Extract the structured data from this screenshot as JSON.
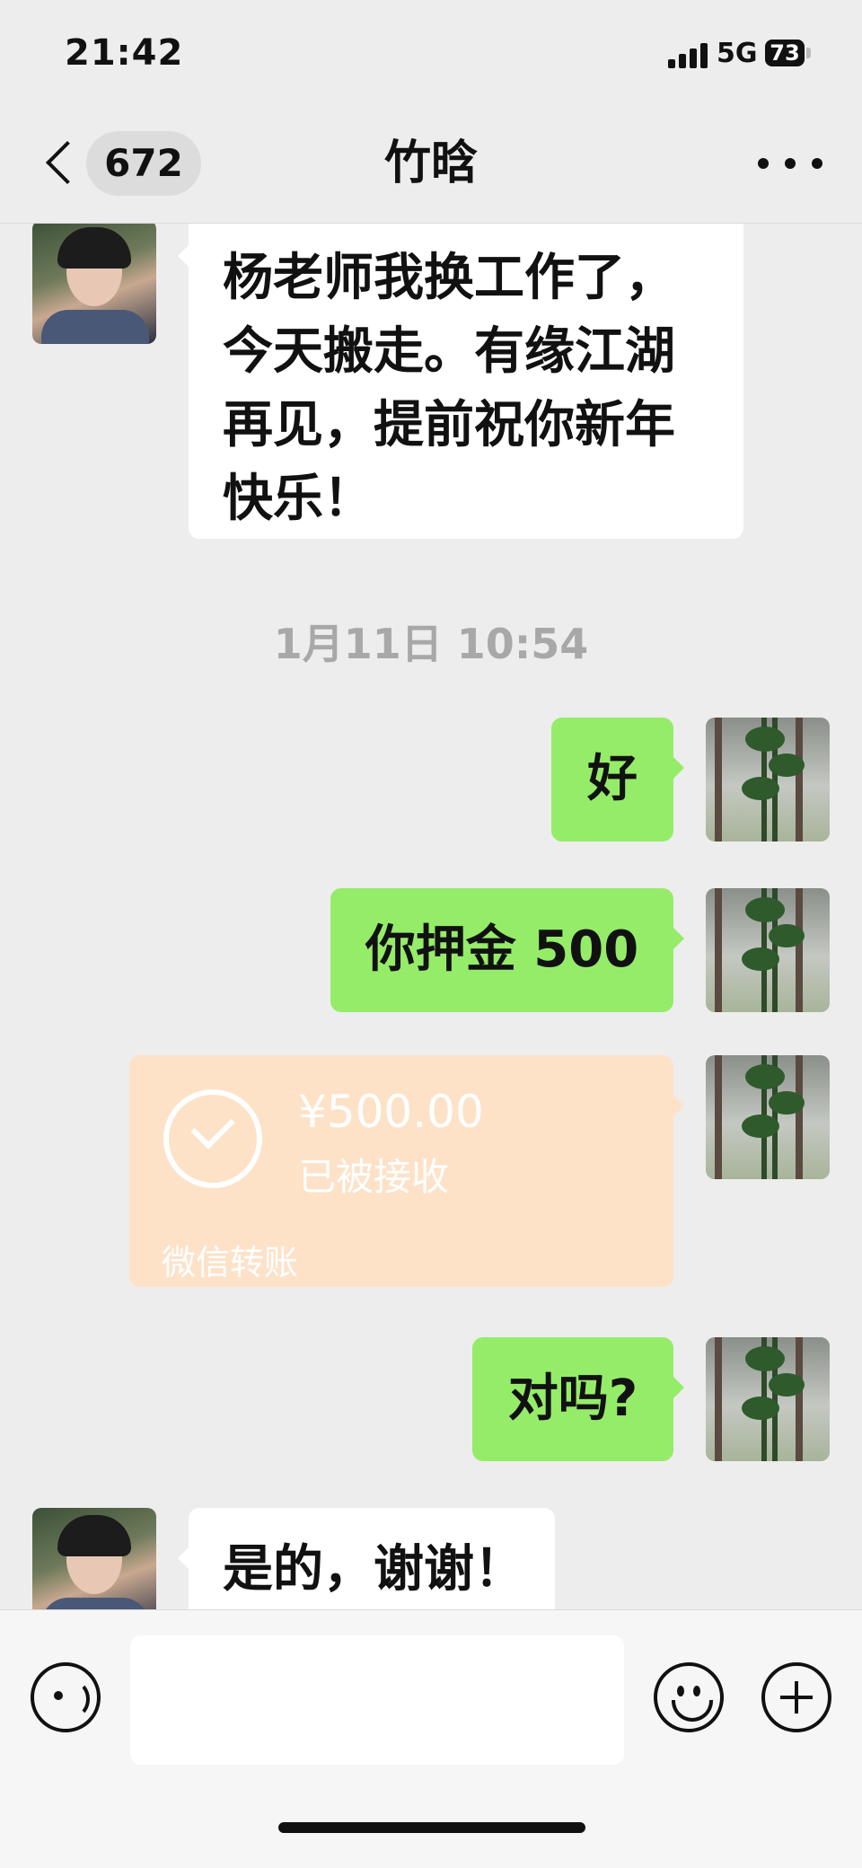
{
  "status_bar": {
    "time": "21:42",
    "network": "5G",
    "battery": "73"
  },
  "nav": {
    "unread_count": "672",
    "title": "竹晗"
  },
  "messages": [
    {
      "sender": "contact",
      "text": "杨老师我换工作了，今天搬走。有缘江湖再见，提前祝你新年快乐！"
    },
    {
      "timestamp": "1月11日 10:54"
    },
    {
      "sender": "me",
      "text": "好"
    },
    {
      "sender": "me",
      "text": "你押金 500"
    },
    {
      "sender": "me",
      "type": "transfer",
      "amount": "¥500.00",
      "status": "已被接收",
      "label": "微信转账"
    },
    {
      "sender": "me",
      "text": "对吗?"
    },
    {
      "sender": "contact",
      "text": "是的，谢谢！"
    }
  ],
  "input_bar": {
    "placeholder": ""
  },
  "colors": {
    "outgoing_bubble": "#95ec69",
    "incoming_bubble": "#ffffff",
    "transfer_card": "#fde2c8",
    "background": "#ededed"
  },
  "icons": [
    "back-chevron-icon",
    "more-icon",
    "voice-icon",
    "emoji-icon",
    "plus-icon",
    "check-icon",
    "signal-icon",
    "battery-icon"
  ]
}
